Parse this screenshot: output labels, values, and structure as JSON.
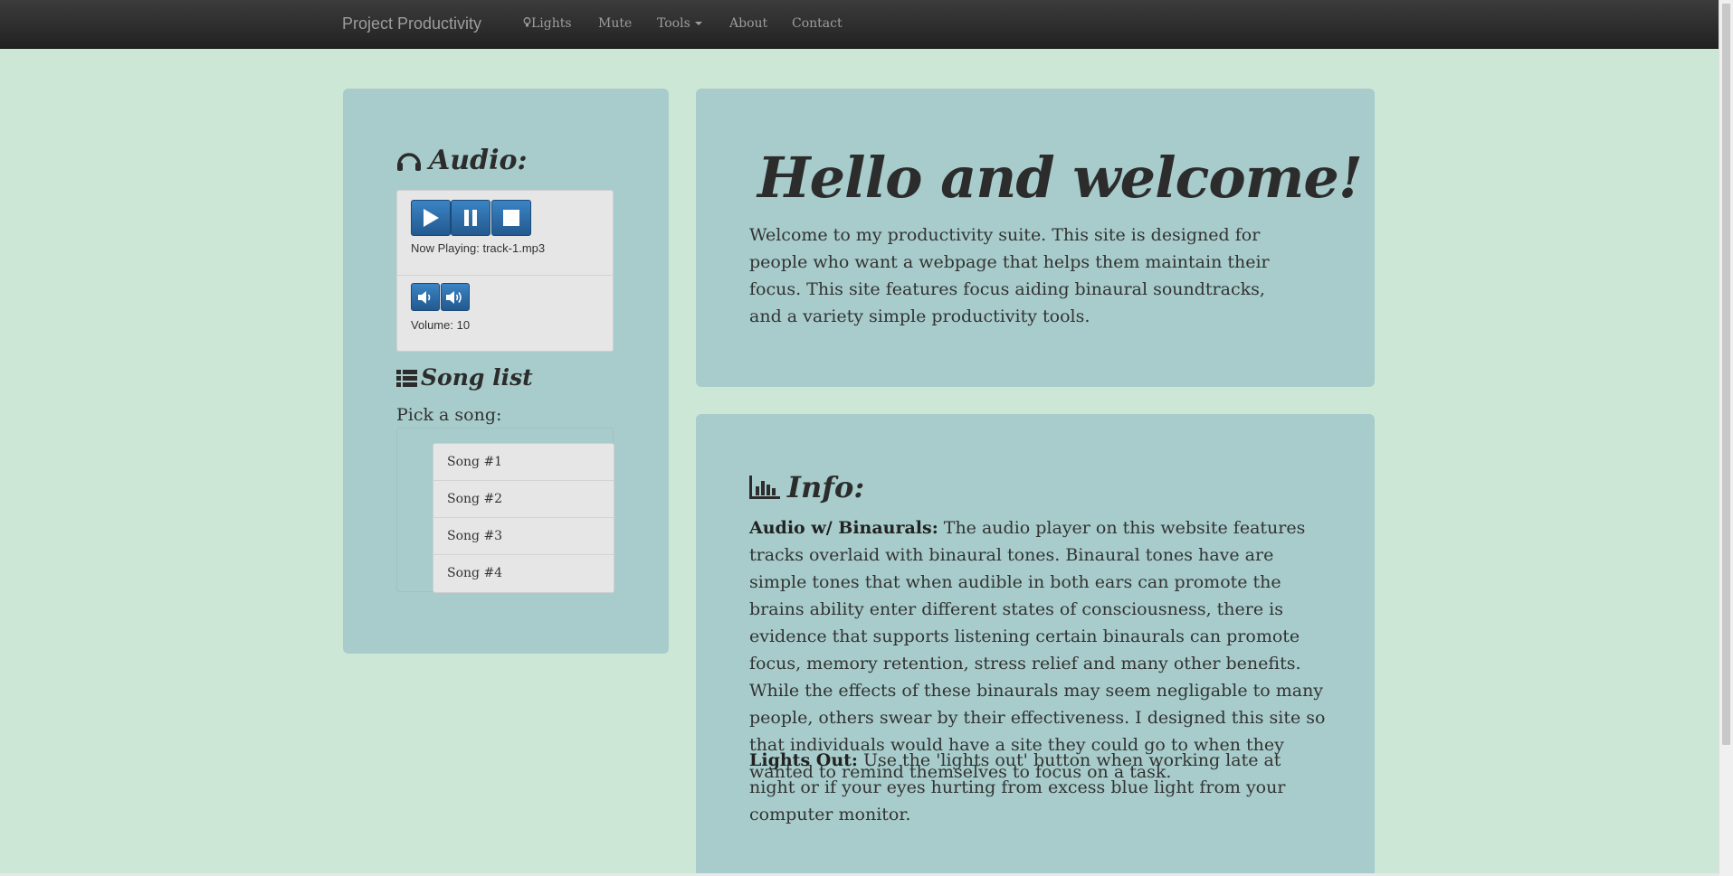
{
  "navbar": {
    "brand": "Project Productivity",
    "items": {
      "lights": "Lights",
      "mute": "Mute",
      "tools": "Tools",
      "about": "About",
      "contact": "Contact"
    }
  },
  "audio": {
    "heading": "Audio:",
    "now_playing": "Now Playing: track-1.mp3",
    "volume": "Volume: 10"
  },
  "songlist": {
    "heading": "Song list",
    "prompt": "Pick a song:",
    "songs": [
      "Song #1",
      "Song #2",
      "Song #3",
      "Song #4"
    ]
  },
  "hero": {
    "title": "Hello and welcome!",
    "text": "Welcome to my productivity suite. This site is designed for people who want a webpage that helps them maintain their focus. This site features focus aiding binaural soundtracks, and a variety simple productivity tools."
  },
  "info": {
    "heading": "Info:",
    "binaurals_label": "Audio w/ Binaurals:",
    "binaurals_text": " The audio player on this website features tracks overlaid with binaural tones. Binaural tones have are simple tones that when audible in both ears can promote the brains ability enter different states of consciousness, there is evidence that supports listening certain binaurals can promote focus, memory retention, stress relief and many other benefits. While the effects of these binaurals may seem negligable to many people, others swear by their effectiveness. I designed this site so that individuals would have a site they could go to when they wanted to remind themselves to focus on a task.",
    "lights_label": "Lights Out:",
    "lights_text": " Use the 'lights out' button when working late at night or if your eyes hurting from excess blue light from your computer monitor."
  },
  "colors": {
    "background": "#cde7d6",
    "panel": "#a7cccb",
    "button_blue": "#2a6aa8",
    "navbar": "#222222"
  },
  "icons": {
    "lights": "lightbulb-icon",
    "audio": "headphones-icon",
    "songlist": "list-icon",
    "info": "bar-chart-icon"
  }
}
